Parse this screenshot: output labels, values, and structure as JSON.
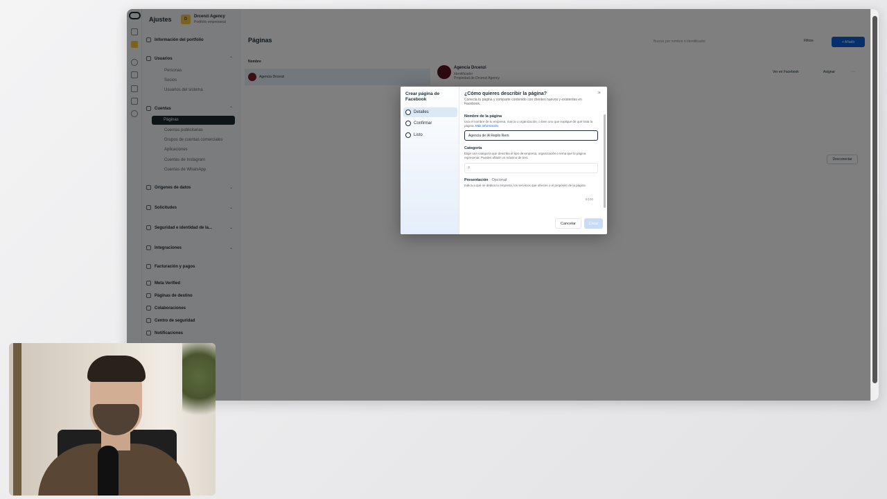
{
  "sidebar": {
    "title": "Ajustes",
    "business_badge": "D",
    "business_name": "Drcenzi Agency",
    "business_sub": "Portfolio empresarial",
    "items": [
      {
        "label": "Información del portfolio"
      },
      {
        "label": "Usuarios",
        "subitems": [
          "Personas",
          "Socios",
          "Usuarios del sistema"
        ]
      },
      {
        "label": "Cuentas",
        "subitems": [
          "Páginas",
          "Cuentas publicitarias",
          "Grupos de cuentas comerciales",
          "Aplicaciones",
          "Cuentas de Instagram",
          "Cuentas de WhatsApp"
        ]
      },
      {
        "label": "Orígenes de datos"
      },
      {
        "label": "Solicitudes"
      },
      {
        "label": "Seguridad e identidad de la..."
      },
      {
        "label": "Integraciones"
      },
      {
        "label": "Facturación y pagos"
      },
      {
        "label": "Meta Verified"
      },
      {
        "label": "Páginas de destino"
      },
      {
        "label": "Colaboraciones"
      },
      {
        "label": "Centro de seguridad"
      },
      {
        "label": "Notificaciones"
      }
    ],
    "active_item": "Páginas"
  },
  "main": {
    "title": "Páginas",
    "search_placeholder": "Buscar por nombre o identificador",
    "filter_label": "Filtros",
    "add_label": "+ Añadir",
    "list_header": "Nombre",
    "rows": [
      "Agencia Drcenzi"
    ],
    "detail_name": "Agencia Drcenzi",
    "detail_sub": "Identificador",
    "detail_sub2": "Propiedad de Drcenzi Agency",
    "view_fb_label": "Ver en Facebook",
    "assign_label": "Asignar",
    "more_label": "⋯",
    "remove_label": "Desconectar"
  },
  "modal": {
    "steps_title": "Crear página de Facebook",
    "steps": [
      "Detalles",
      "Confirmar",
      "Listo"
    ],
    "active_step": "Detalles",
    "title": "¿Cómo quieres describir la página?",
    "description": "Conecta tu página y comparte contenido con clientes nuevos y existentes en Facebook.",
    "name_label": "Nombre de la página",
    "name_help": "Usa el nombre de tu empresa, marca u organización, o bien uno que explique de qué trata la página.",
    "name_help_link": "Más información",
    "name_value": "Agencia de IA Repilo Rem",
    "category_label": "Categoría",
    "category_help": "Elige una categoría que describa el tipo de empresa, organización o tema que la página representa. Puedes añadir un máximo de tres.",
    "bio_label": "Presentación",
    "bio_optional": "· Opcional",
    "bio_help": "Indica a qué se dedica tu empresa, los servicios que ofreces o el propósito de la página.",
    "bio_counter": "0/100",
    "cancel_label": "Cancelar",
    "next_label": "Crear",
    "close_icon": "×"
  }
}
